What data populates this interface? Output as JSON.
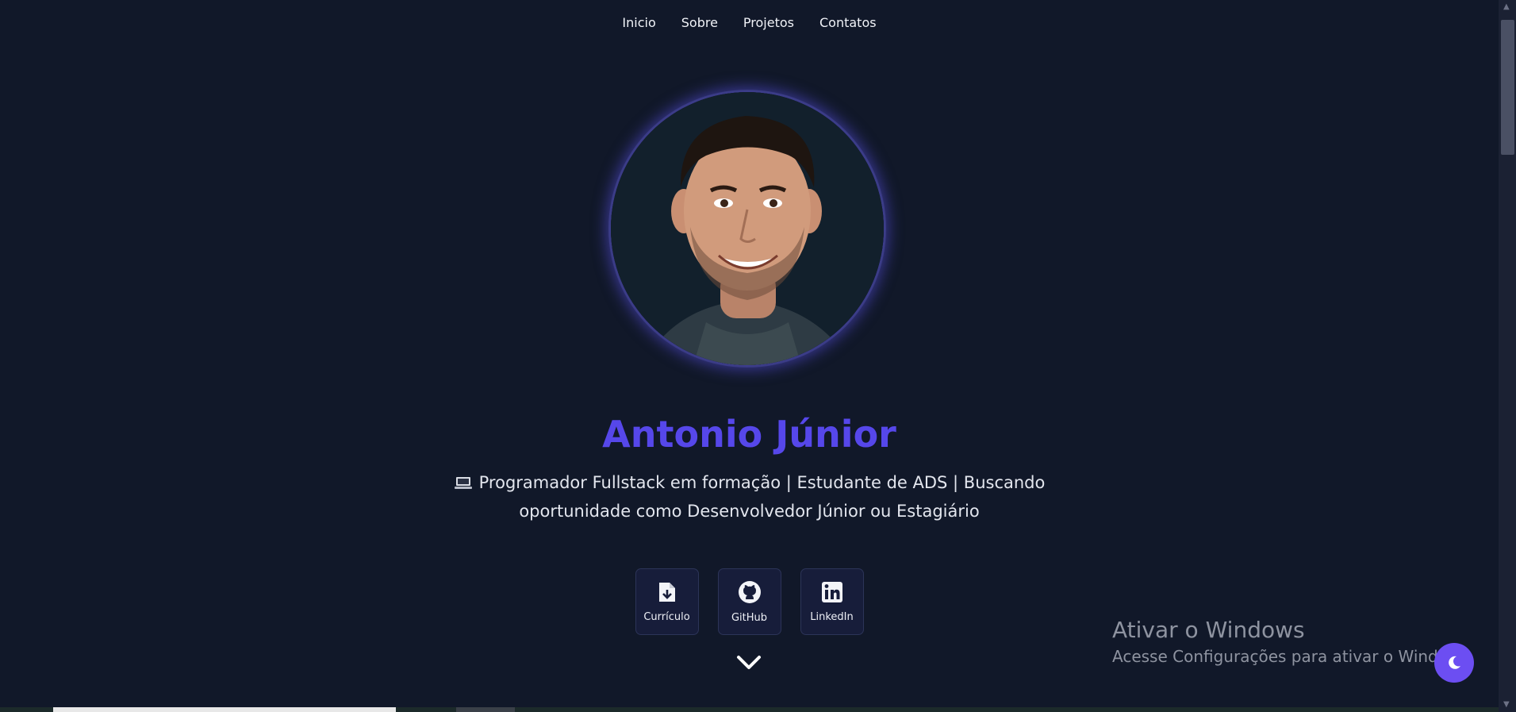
{
  "nav": {
    "items": [
      "Inicio",
      "Sobre",
      "Projetos",
      "Contatos"
    ]
  },
  "profile": {
    "name": "Antonio Júnior",
    "tagline": "Programador Fullstack em formação | Estudante de ADS | Buscando oportunidade como Desenvolvedor Júnior ou Estagiário",
    "avatar_alt": "profile-photo"
  },
  "links": [
    {
      "label": "Currículo",
      "icon": "file-download-icon"
    },
    {
      "label": "GitHub",
      "icon": "github-icon"
    },
    {
      "label": "LinkedIn",
      "icon": "linkedin-icon"
    }
  ],
  "watermark": {
    "title": "Ativar o Windows",
    "subtitle": "Acesse Configurações para ativar o Windows."
  },
  "colors": {
    "background": "#111829",
    "accent": "#5647ea",
    "theme_button": "#6c4ef2"
  }
}
